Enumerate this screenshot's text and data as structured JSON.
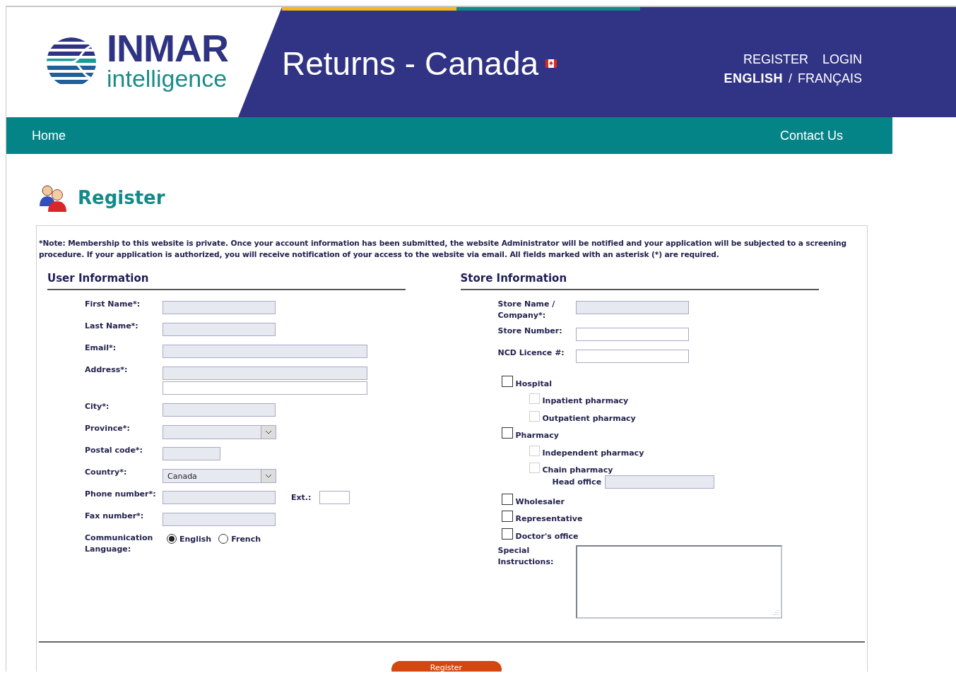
{
  "header": {
    "logo": {
      "wordmark": "INMAR",
      "tagline": "intelligence"
    },
    "title": "Returns - Canada",
    "account_links": [
      "REGISTER",
      "LOGIN"
    ],
    "languages": [
      {
        "label": "ENGLISH",
        "selected": true
      },
      {
        "label": "FRANÇAIS",
        "selected": false
      }
    ],
    "language_separator": "/"
  },
  "nav": {
    "left": [
      "Home"
    ],
    "right": [
      "Contact Us"
    ]
  },
  "page_title": "Register",
  "note": "*Note: Membership to this website is private. Once your account information has been submitted, the website Administrator will be notified and your application will be subjected to a screening procedure. If your application is authorized, you will receive notification of your access to the website via email. All fields marked with an asterisk (*) are required.",
  "user_information": {
    "title": "User Information",
    "fields": [
      {
        "label": "First Name*:",
        "kind": "text",
        "required": true
      },
      {
        "label": "Last Name*:",
        "kind": "text",
        "required": true
      },
      {
        "label": "Email*:",
        "kind": "wide",
        "required": true
      },
      {
        "label": "Address*:",
        "kind": "address",
        "required": true
      },
      {
        "label": "City*:",
        "kind": "text",
        "required": true
      },
      {
        "label": "Province*:",
        "kind": "select",
        "required": true
      },
      {
        "label": "Postal code*:",
        "kind": "short",
        "required": true
      },
      {
        "label": "Country*:",
        "kind": "select",
        "required": true,
        "value": "Canada"
      },
      {
        "label": "Phone number*:",
        "kind": "phone",
        "required": true,
        "ext_label": "Ext.:"
      },
      {
        "label": "Fax number*:",
        "kind": "text",
        "required": true
      },
      {
        "label": "Communication Language:",
        "kind": "radio",
        "options": [
          {
            "label": "English",
            "selected": true
          },
          {
            "label": "French",
            "selected": false
          }
        ]
      }
    ]
  },
  "store_information": {
    "title": "Store Information",
    "fields": [
      {
        "label": "Store Name / Company*:",
        "kind": "text",
        "required": true
      },
      {
        "label": "Store Number:",
        "kind": "text",
        "required": false
      },
      {
        "label": "NCD Licence #:",
        "kind": "text",
        "required": false
      }
    ],
    "types": [
      {
        "label": "Hospital",
        "checked": false,
        "disabled": false,
        "children": [
          {
            "label": "Inpatient pharmacy",
            "checked": false,
            "disabled": true
          },
          {
            "label": "Outpatient pharmacy",
            "checked": false,
            "disabled": true
          }
        ]
      },
      {
        "label": "Pharmacy",
        "checked": false,
        "disabled": false,
        "children": [
          {
            "label": "Independent pharmacy",
            "checked": false,
            "disabled": true
          },
          {
            "label": "Chain pharmacy",
            "checked": false,
            "disabled": true
          }
        ],
        "extra_field": {
          "label": "Head office"
        }
      },
      {
        "label": "Wholesaler",
        "checked": false,
        "disabled": false
      },
      {
        "label": "Representative",
        "checked": false,
        "disabled": false
      },
      {
        "label": "Doctor's office",
        "checked": false,
        "disabled": false
      }
    ],
    "instructions_label": "Special Instructions:"
  },
  "submit_button": "Register"
}
